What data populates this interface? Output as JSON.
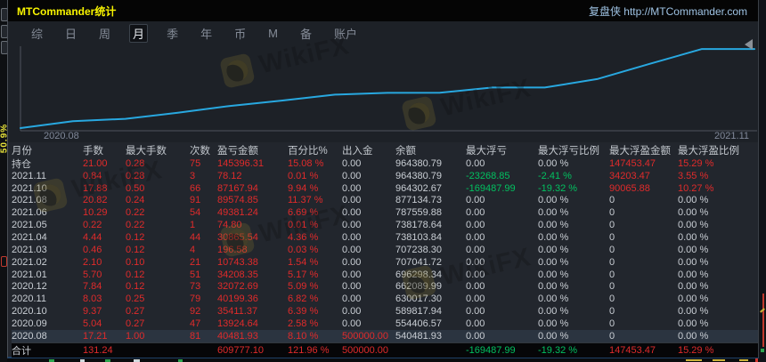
{
  "window": {
    "title": "MTCommander统计",
    "brand": "复盘侠 http://MTCommander.com"
  },
  "menu": {
    "items": [
      {
        "id": "zong",
        "label": "综"
      },
      {
        "id": "ri",
        "label": "日"
      },
      {
        "id": "zhou",
        "label": "周"
      },
      {
        "id": "yue",
        "label": "月",
        "selected": true
      },
      {
        "id": "ji",
        "label": "季"
      },
      {
        "id": "nian",
        "label": "年"
      },
      {
        "id": "bi",
        "label": "币"
      },
      {
        "id": "m",
        "label": "M"
      },
      {
        "id": "bei",
        "label": "备"
      },
      {
        "id": "zhanghu",
        "label": "账户"
      }
    ]
  },
  "background": {
    "vertical_label": "50.9%"
  },
  "watermark": {
    "text": "WikiFX"
  },
  "chart_data": {
    "type": "line",
    "x_start_label": "2020.08",
    "x_end_label": "2021.11",
    "months": [
      "2020.08",
      "2020.09",
      "2020.10",
      "2020.11",
      "2020.12",
      "2021.01",
      "2021.02",
      "2021.03",
      "2021.04",
      "2021.05",
      "2021.06",
      "2021.08",
      "2021.10",
      "2021.11"
    ],
    "start_balance": 500000.0,
    "balances": [
      540481.93,
      554406.57,
      589817.94,
      630017.3,
      662089.99,
      696298.34,
      707041.72,
      707238.3,
      738103.84,
      738178.64,
      787559.88,
      877134.73,
      964302.67,
      964380.79
    ],
    "ylim": [
      500000,
      970000
    ],
    "line_color": "#28a8e0",
    "legend": [],
    "grid": false
  },
  "colors": {
    "red": "#e02b2b",
    "green": "#02c060",
    "white": "#c9ced4"
  },
  "table": {
    "columns": [
      {
        "id": "month",
        "label": "月份"
      },
      {
        "id": "lots",
        "label": "手数"
      },
      {
        "id": "max-lots",
        "label": "最大手数"
      },
      {
        "id": "count",
        "label": "次数"
      },
      {
        "id": "pnl",
        "label": "盈亏金额"
      },
      {
        "id": "percent",
        "label": "百分比%"
      },
      {
        "id": "deposit",
        "label": "出入金"
      },
      {
        "id": "balance",
        "label": "余额"
      },
      {
        "id": "max-float-loss",
        "label": "最大浮亏"
      },
      {
        "id": "max-float-loss-pct",
        "label": "最大浮亏比例"
      },
      {
        "id": "max-float-profit",
        "label": "最大浮盈金额"
      },
      {
        "id": "max-float-profit-pct",
        "label": "最大浮盈比例"
      }
    ],
    "rows": [
      {
        "cells": [
          "持仓",
          "21.00",
          "0.28",
          "75",
          "145396.31",
          "15.08 %",
          "0.00",
          "964380.79",
          "0.00",
          "0.00 %",
          "147453.47",
          "15.29 %"
        ],
        "colors": [
          "w",
          "r",
          "r",
          "r",
          "r",
          "r",
          "w",
          "w",
          "w",
          "w",
          "r",
          "r"
        ]
      },
      {
        "cells": [
          "2021.11",
          "0.84",
          "0.28",
          "3",
          "78.12",
          "0.01 %",
          "0.00",
          "964380.79",
          "-23268.85",
          "-2.41 %",
          "34203.47",
          "3.55 %"
        ],
        "colors": [
          "w",
          "r",
          "r",
          "r",
          "r",
          "r",
          "w",
          "w",
          "g",
          "g",
          "r",
          "r"
        ]
      },
      {
        "cells": [
          "2021.10",
          "17.88",
          "0.50",
          "66",
          "87167.94",
          "9.94 %",
          "0.00",
          "964302.67",
          "-169487.99",
          "-19.32 %",
          "90065.88",
          "10.27 %"
        ],
        "colors": [
          "w",
          "r",
          "r",
          "r",
          "r",
          "r",
          "w",
          "w",
          "g",
          "g",
          "r",
          "r"
        ]
      },
      {
        "cells": [
          "2021.08",
          "20.82",
          "0.24",
          "91",
          "89574.85",
          "11.37 %",
          "0.00",
          "877134.73",
          "0.00",
          "0.00 %",
          "0",
          "0.00 %"
        ],
        "colors": [
          "w",
          "r",
          "r",
          "r",
          "r",
          "r",
          "w",
          "w",
          "w",
          "w",
          "w",
          "w"
        ]
      },
      {
        "cells": [
          "2021.06",
          "10.29",
          "0.22",
          "54",
          "49381.24",
          "6.69 %",
          "0.00",
          "787559.88",
          "0.00",
          "0.00 %",
          "0",
          "0.00 %"
        ],
        "colors": [
          "w",
          "r",
          "r",
          "r",
          "r",
          "r",
          "w",
          "w",
          "w",
          "w",
          "w",
          "w"
        ]
      },
      {
        "cells": [
          "2021.05",
          "0.22",
          "0.22",
          "1",
          "74.80",
          "0.01 %",
          "0.00",
          "738178.64",
          "0.00",
          "0.00 %",
          "0",
          "0.00 %"
        ],
        "colors": [
          "w",
          "r",
          "r",
          "r",
          "r",
          "r",
          "w",
          "w",
          "w",
          "w",
          "w",
          "w"
        ]
      },
      {
        "cells": [
          "2021.04",
          "4.44",
          "0.12",
          "44",
          "30865.54",
          "4.36 %",
          "0.00",
          "738103.84",
          "0.00",
          "0.00 %",
          "0",
          "0.00 %"
        ],
        "colors": [
          "w",
          "r",
          "r",
          "r",
          "r",
          "r",
          "w",
          "w",
          "w",
          "w",
          "w",
          "w"
        ]
      },
      {
        "cells": [
          "2021.03",
          "0.46",
          "0.12",
          "4",
          "196.58",
          "0.03 %",
          "0.00",
          "707238.30",
          "0.00",
          "0.00 %",
          "0",
          "0.00 %"
        ],
        "colors": [
          "w",
          "r",
          "r",
          "r",
          "r",
          "r",
          "w",
          "w",
          "w",
          "w",
          "w",
          "w"
        ]
      },
      {
        "cells": [
          "2021.02",
          "2.10",
          "0.10",
          "21",
          "10743.38",
          "1.54 %",
          "0.00",
          "707041.72",
          "0.00",
          "0.00 %",
          "0",
          "0.00 %"
        ],
        "colors": [
          "w",
          "r",
          "r",
          "r",
          "r",
          "r",
          "w",
          "w",
          "w",
          "w",
          "w",
          "w"
        ]
      },
      {
        "cells": [
          "2021.01",
          "5.70",
          "0.12",
          "51",
          "34208.35",
          "5.17 %",
          "0.00",
          "696298.34",
          "0.00",
          "0.00 %",
          "0",
          "0.00 %"
        ],
        "colors": [
          "w",
          "r",
          "r",
          "r",
          "r",
          "r",
          "w",
          "w",
          "w",
          "w",
          "w",
          "w"
        ]
      },
      {
        "cells": [
          "2020.12",
          "7.84",
          "0.12",
          "73",
          "32072.69",
          "5.09 %",
          "0.00",
          "662089.99",
          "0.00",
          "0.00 %",
          "0",
          "0.00 %"
        ],
        "colors": [
          "w",
          "r",
          "r",
          "r",
          "r",
          "r",
          "w",
          "w",
          "w",
          "w",
          "w",
          "w"
        ]
      },
      {
        "cells": [
          "2020.11",
          "8.03",
          "0.25",
          "79",
          "40199.36",
          "6.82 %",
          "0.00",
          "630017.30",
          "0.00",
          "0.00 %",
          "0",
          "0.00 %"
        ],
        "colors": [
          "w",
          "r",
          "r",
          "r",
          "r",
          "r",
          "w",
          "w",
          "w",
          "w",
          "w",
          "w"
        ]
      },
      {
        "cells": [
          "2020.10",
          "9.37",
          "0.27",
          "92",
          "35411.37",
          "6.39 %",
          "0.00",
          "589817.94",
          "0.00",
          "0.00 %",
          "0",
          "0.00 %"
        ],
        "colors": [
          "w",
          "r",
          "r",
          "r",
          "r",
          "r",
          "w",
          "w",
          "w",
          "w",
          "w",
          "w"
        ]
      },
      {
        "cells": [
          "2020.09",
          "5.04",
          "0.27",
          "47",
          "13924.64",
          "2.58 %",
          "0.00",
          "554406.57",
          "0.00",
          "0.00 %",
          "0",
          "0.00 %"
        ],
        "colors": [
          "w",
          "r",
          "r",
          "r",
          "r",
          "r",
          "w",
          "w",
          "w",
          "w",
          "w",
          "w"
        ]
      },
      {
        "cells": [
          "2020.08",
          "17.21",
          "1.00",
          "81",
          "40481.93",
          "8.10 %",
          "500000.00",
          "540481.93",
          "0.00",
          "0.00 %",
          "0",
          "0.00 %"
        ],
        "colors": [
          "w",
          "r",
          "r",
          "r",
          "r",
          "r",
          "r",
          "w",
          "w",
          "w",
          "w",
          "w"
        ],
        "selected": true
      }
    ],
    "total": {
      "cells": [
        "合计",
        "131.24",
        "",
        "",
        "609777.10",
        "121.96 %",
        "500000.00",
        "",
        "-169487.99",
        "-19.32 %",
        "147453.47",
        "15.29 %"
      ],
      "colors": [
        "w",
        "r",
        "w",
        "w",
        "r",
        "r",
        "r",
        "w",
        "g",
        "g",
        "r",
        "r"
      ]
    }
  }
}
